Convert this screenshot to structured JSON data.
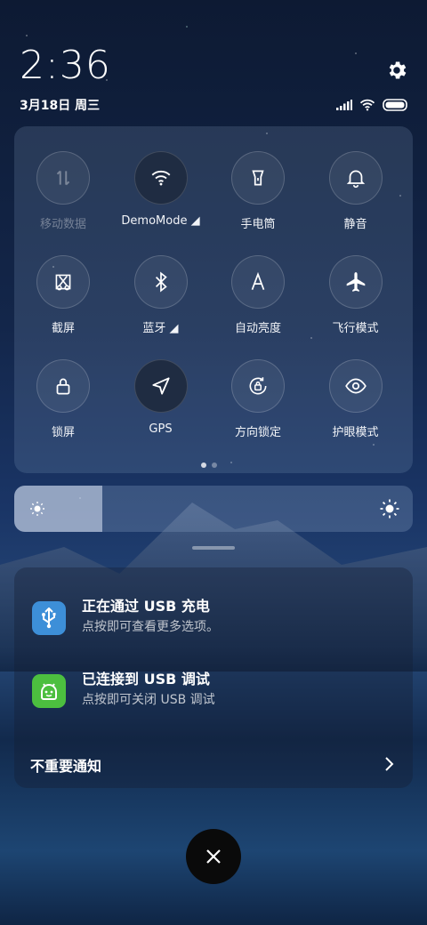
{
  "status_bar": {
    "time": "2:36",
    "date": "3月18日 周三",
    "icons": [
      "signal-icon",
      "wifi-icon",
      "battery-icon"
    ]
  },
  "quick_tiles": [
    {
      "label": "移动数据",
      "icon": "mobile-data-icon",
      "state": "disabled"
    },
    {
      "label": "DemoMode ◢",
      "icon": "wifi-icon",
      "state": "active"
    },
    {
      "label": "手电筒",
      "icon": "flashlight-icon",
      "state": "off"
    },
    {
      "label": "静音",
      "icon": "bell-icon",
      "state": "off"
    },
    {
      "label": "截屏",
      "icon": "screenshot-icon",
      "state": "off"
    },
    {
      "label": "蓝牙 ◢",
      "icon": "bluetooth-icon",
      "state": "off"
    },
    {
      "label": "自动亮度",
      "icon": "auto-brightness-icon",
      "state": "off"
    },
    {
      "label": "飞行模式",
      "icon": "airplane-icon",
      "state": "off"
    },
    {
      "label": "锁屏",
      "icon": "lock-icon",
      "state": "off"
    },
    {
      "label": "GPS",
      "icon": "location-icon",
      "state": "active"
    },
    {
      "label": "方向锁定",
      "icon": "rotation-lock-icon",
      "state": "off"
    },
    {
      "label": "护眼模式",
      "icon": "eye-icon",
      "state": "off"
    }
  ],
  "page_indicator": {
    "current": 1,
    "total": 2
  },
  "brightness": {
    "level": 0.22
  },
  "notifications": [
    {
      "title": "正在通过 USB 充电",
      "body": "点按即可查看更多选项。",
      "icon": "usb-icon",
      "color": "#3d8fd8"
    },
    {
      "title": "已连接到 USB 调试",
      "body": "点按即可关闭 USB 调试",
      "icon": "android-debug-icon",
      "color": "#4cbf3f"
    }
  ],
  "notification_group": {
    "label": "不重要通知"
  }
}
